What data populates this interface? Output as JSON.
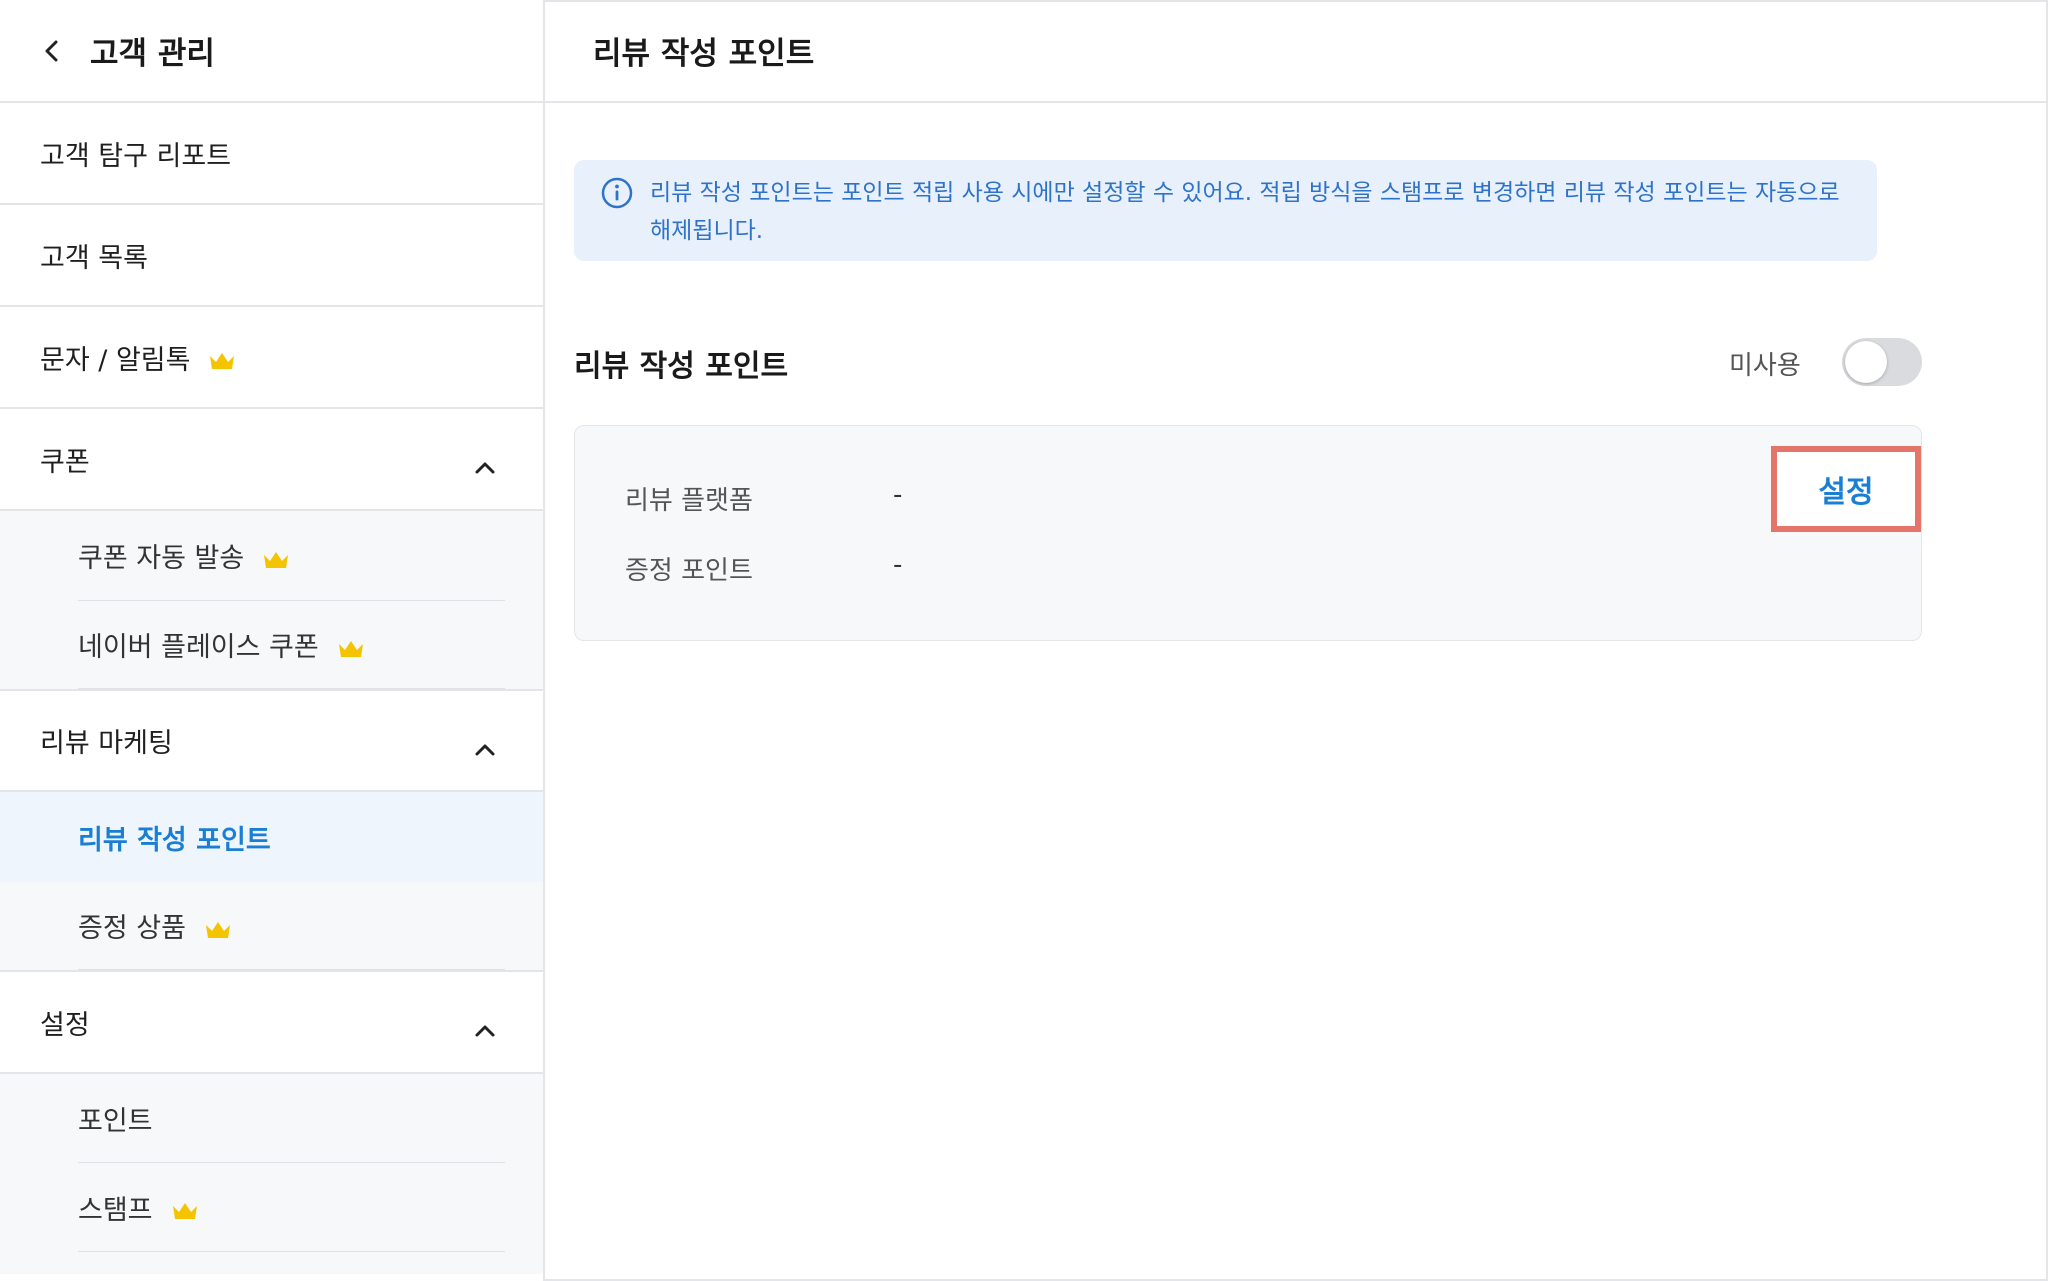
{
  "sidebar": {
    "title": "고객 관리",
    "items": [
      {
        "label": "고객 탐구 리포트"
      },
      {
        "label": "고객 목록"
      },
      {
        "label": "문자 / 알림톡"
      },
      {
        "label": "쿠폰"
      },
      {
        "label": "리뷰 마케팅"
      },
      {
        "label": "설정"
      }
    ],
    "coupon_sub": [
      {
        "label": "쿠폰 자동 발송"
      },
      {
        "label": "네이버 플레이스 쿠폰"
      }
    ],
    "review_sub": [
      {
        "label": "리뷰 작성 포인트"
      },
      {
        "label": "증정 상품"
      }
    ],
    "settings_sub": [
      {
        "label": "포인트"
      },
      {
        "label": "스탬프"
      }
    ]
  },
  "main": {
    "title": "리뷰 작성 포인트",
    "info": "리뷰 작성 포인트는 포인트 적립 사용 시에만 설정할 수 있어요. 적립 방식을 스탬프로 변경하면 리뷰 작성 포인트는 자동으로 해제됩니다.",
    "section_title": "리뷰 작성 포인트",
    "toggle_label": "미사용",
    "toggle_on": false,
    "card": {
      "rows": [
        {
          "label": "리뷰 플랫폼",
          "value": "-"
        },
        {
          "label": "증정 포인트",
          "value": "-"
        }
      ],
      "button_label": "설정"
    }
  },
  "colors": {
    "accent": "#1a7fd4",
    "crown": "#f5c400",
    "info_bg": "#e8f0fb",
    "info_text": "#2f73c9",
    "highlight_border": "#e5746a"
  }
}
